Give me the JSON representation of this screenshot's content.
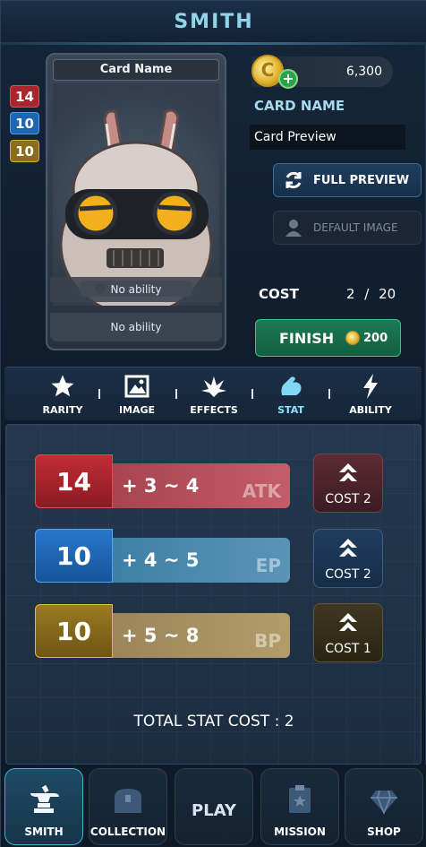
{
  "header": {
    "title": "SMITH"
  },
  "card": {
    "name": "Card Name",
    "atk": "14",
    "ep": "10",
    "bp": "10",
    "ability_1": "No ability",
    "ability_2": "No ability"
  },
  "currency": {
    "amount": "6,300"
  },
  "editor": {
    "card_name_label": "CARD NAME",
    "card_name_value": "Card Preview",
    "full_preview_label": "FULL PREVIEW",
    "default_image_label": "DEFAULT IMAGE",
    "cost_label": "COST",
    "cost_value": "2 / 20",
    "cost_current": 2,
    "cost_max": 20,
    "finish_label": "FINISH",
    "finish_price": "200"
  },
  "tabs": [
    {
      "label": "RARITY",
      "icon": "star-icon"
    },
    {
      "label": "IMAGE",
      "icon": "image-icon"
    },
    {
      "label": "EFFECTS",
      "icon": "effects-icon"
    },
    {
      "label": "STAT",
      "icon": "muscle-icon",
      "active": true
    },
    {
      "label": "ABILITY",
      "icon": "lightning-icon"
    }
  ],
  "stats": [
    {
      "value": "14",
      "range": "+ 3 ~ 4",
      "name": "ATK",
      "upgrade_cost": "COST 2",
      "color": "#c22c36"
    },
    {
      "value": "10",
      "range": "+ 4 ~ 5",
      "name": "EP",
      "upgrade_cost": "COST 2",
      "color": "#2777cc"
    },
    {
      "value": "10",
      "range": "+ 5 ~ 8",
      "name": "BP",
      "upgrade_cost": "COST 1",
      "color": "#9a7a24"
    }
  ],
  "total_stat_cost": "TOTAL STAT COST : 2",
  "nav": [
    {
      "label": "SMITH",
      "icon": "anvil-icon",
      "active": true
    },
    {
      "label": "COLLECTION",
      "icon": "chest-icon"
    },
    {
      "label": "PLAY"
    },
    {
      "label": "MISSION",
      "icon": "mission-board-icon"
    },
    {
      "label": "SHOP",
      "icon": "gem-icon"
    }
  ],
  "colors": {
    "accent_cyan": "#8fd4e8",
    "finish_green": "#1c7a55",
    "atk_red": "#c22c36",
    "ep_blue": "#2777cc",
    "bp_gold": "#9a7a24"
  }
}
